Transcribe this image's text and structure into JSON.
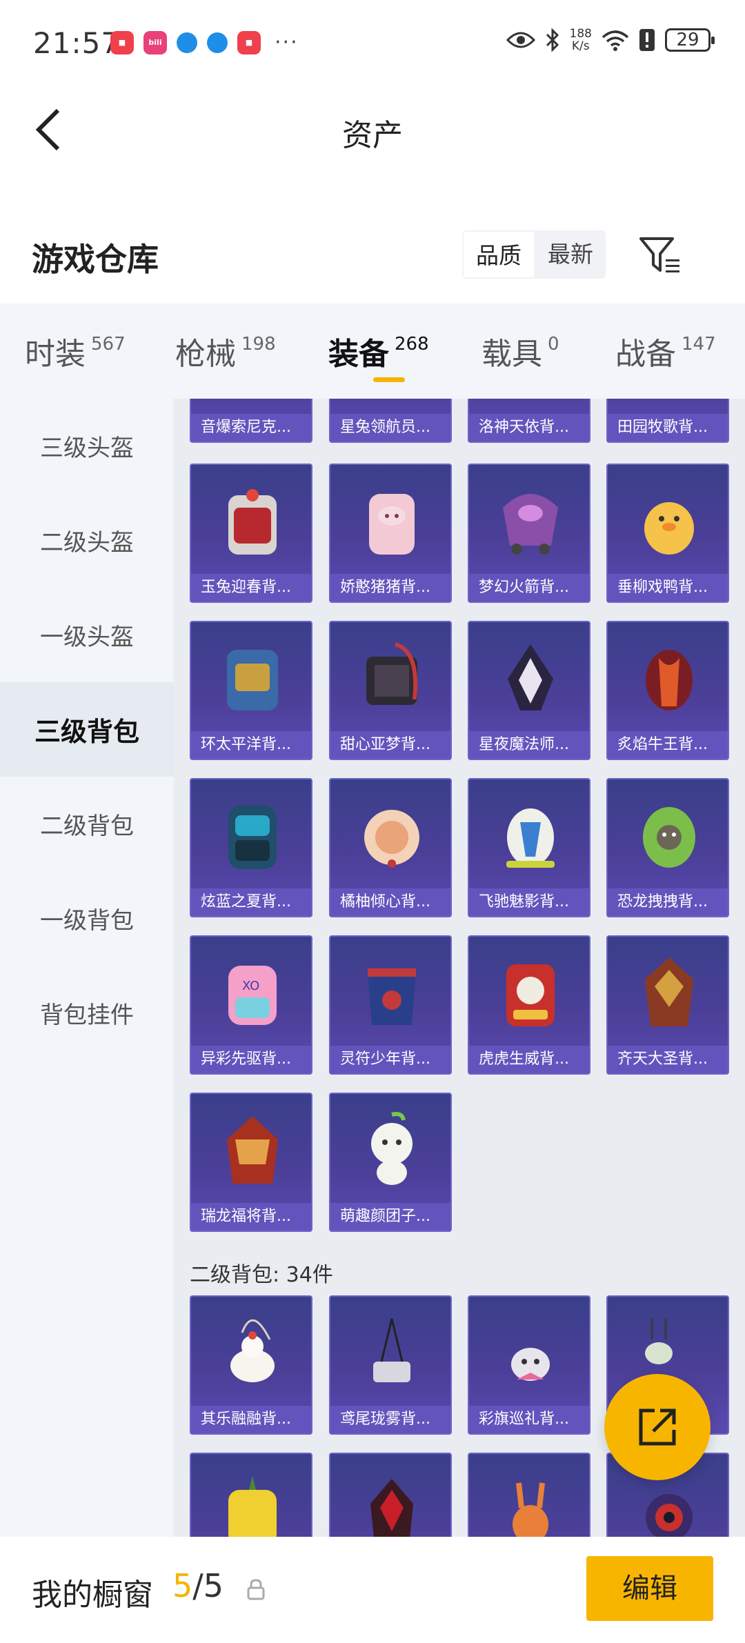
{
  "status_bar": {
    "time": "21:57",
    "app_badges": [
      "shopping-bag-icon",
      "bilibili-icon",
      "browser-icon",
      "browser-icon",
      "shopping-bag-icon"
    ],
    "more": "···",
    "speed_top": "188",
    "speed_unit": "K/s",
    "battery": "29"
  },
  "header": {
    "title": "资产"
  },
  "section": {
    "title": "游戏仓库",
    "sort_options": [
      "品质",
      "最新"
    ],
    "sort_selected": "品质"
  },
  "tabs": [
    {
      "label": "时装",
      "count": "567"
    },
    {
      "label": "枪械",
      "count": "198"
    },
    {
      "label": "装备",
      "count": "268",
      "active": true
    },
    {
      "label": "载具",
      "count": "0"
    },
    {
      "label": "战备",
      "count": "147"
    }
  ],
  "leftnav": [
    "三级头盔",
    "二级头盔",
    "一级头盔",
    "三级背包",
    "二级背包",
    "一级背包",
    "背包挂件"
  ],
  "leftnav_active": "三级背包",
  "grid": {
    "row0": [
      "音爆索尼克...",
      "星兔领航员...",
      "洛神天依背...",
      "田园牧歌背..."
    ],
    "row1": [
      "玉兔迎春背...",
      "娇憨猪猪背...",
      "梦幻火箭背...",
      "垂柳戏鸭背..."
    ],
    "row2": [
      "环太平洋背...",
      "甜心亚梦背...",
      "星夜魔法师...",
      "炙焰牛王背..."
    ],
    "row3": [
      "炫蓝之夏背...",
      "橘柚倾心背...",
      "飞驰魅影背...",
      "恐龙拽拽背..."
    ],
    "row4": [
      "异彩先驱背...",
      "灵符少年背...",
      "虎虎生威背...",
      "齐天大圣背..."
    ],
    "row5": [
      "瑞龙福将背...",
      "萌趣颜团子..."
    ],
    "subheader": "二级背包: 34件",
    "row6": [
      "其乐融融背...",
      "鸢尾珑雾背...",
      "彩旗巡礼背...",
      ""
    ],
    "row7": [
      "",
      "",
      "",
      ""
    ]
  },
  "colors": {
    "accent": "#f8b500",
    "card_top": "#3a3f8a",
    "card_label": "#6455be"
  },
  "bottom_bar": {
    "title": "我的橱窗",
    "count_current": "5",
    "count_sep": "/5",
    "edit_label": "编辑"
  }
}
